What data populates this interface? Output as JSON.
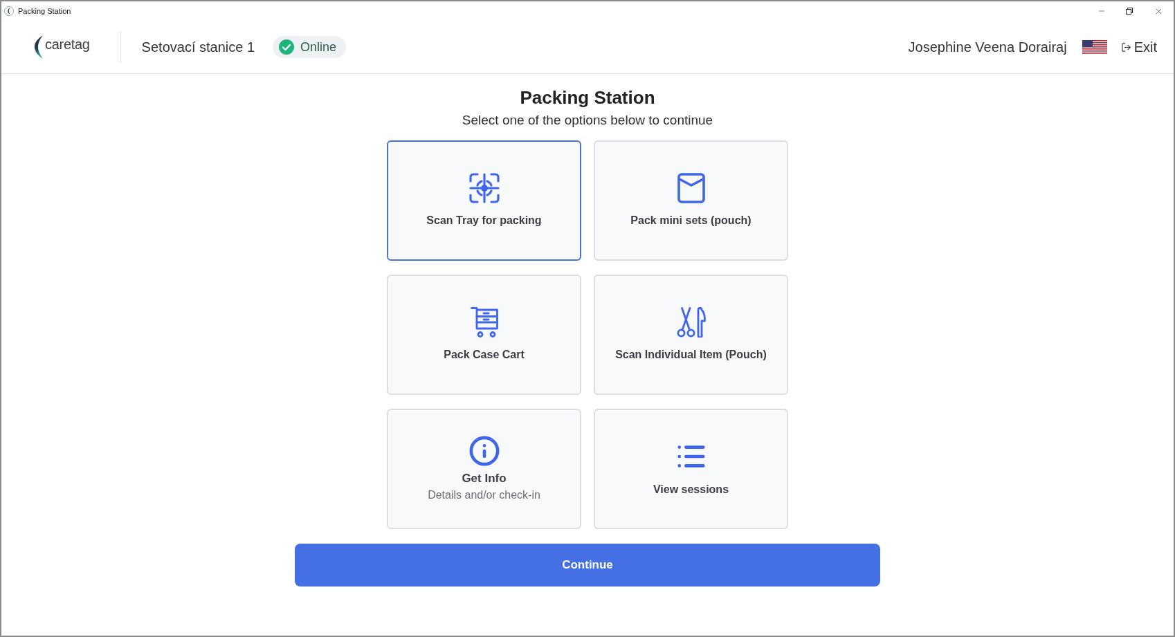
{
  "window": {
    "title": "Packing Station"
  },
  "header": {
    "logo": "caretag",
    "station": "Setovací stanice 1",
    "status": {
      "label": "Online",
      "online": true
    },
    "user": "Josephine Veena Dorairaj",
    "exit": "Exit"
  },
  "page": {
    "title": "Packing Station",
    "subtitle": "Select one of the options below to continue"
  },
  "options": [
    {
      "label": "Scan Tray for packing",
      "selected": true
    },
    {
      "label": "Pack mini sets (pouch)",
      "selected": false
    },
    {
      "label": "Pack Case Cart",
      "selected": false
    },
    {
      "label": "Scan Individual Item (Pouch)",
      "selected": false
    },
    {
      "label": "Get Info",
      "description": "Details and/or check-in",
      "selected": false
    },
    {
      "label": "View sessions",
      "selected": false
    }
  ],
  "continue_button": {
    "label": "Continue"
  }
}
